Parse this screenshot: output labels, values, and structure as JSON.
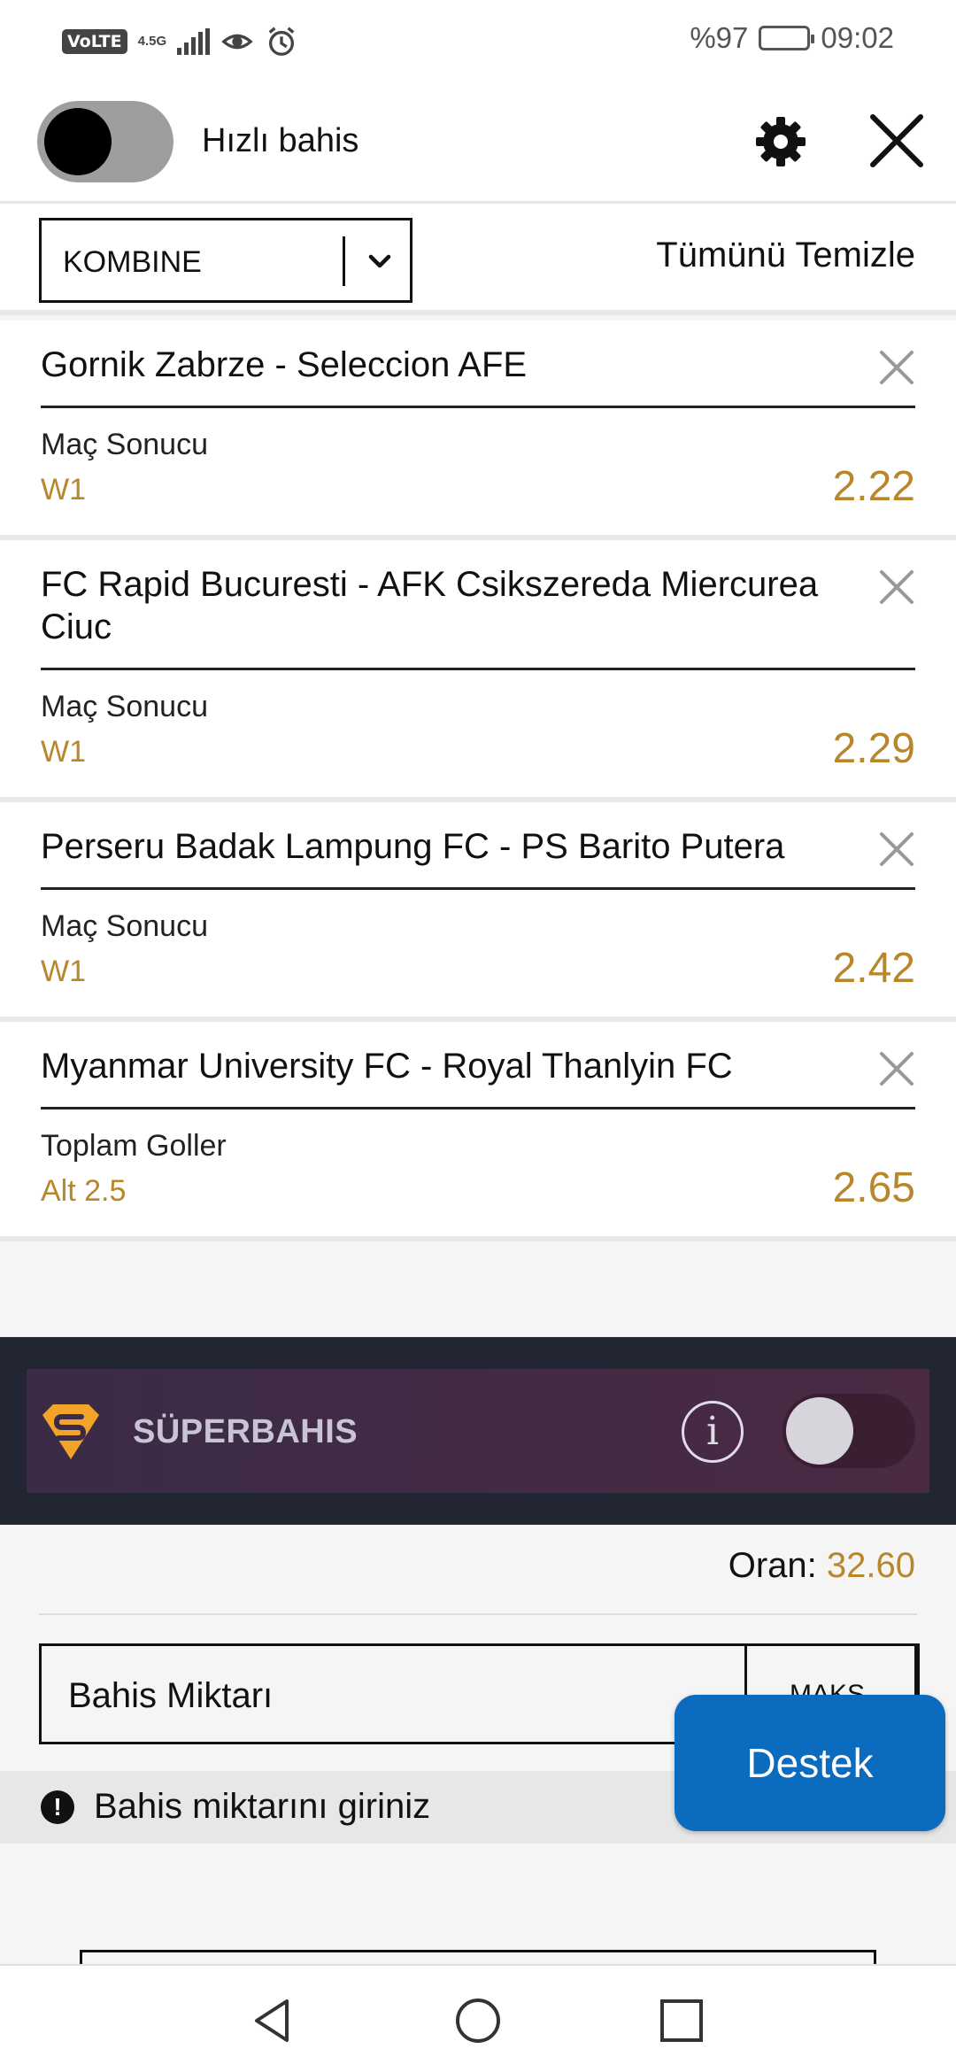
{
  "status_bar": {
    "volte": "VoLTE",
    "network": "4.5G",
    "battery_text": "%97",
    "time": "09:02",
    "icons": [
      "signal-icon",
      "eye-icon",
      "alarm-icon",
      "battery-icon"
    ]
  },
  "header": {
    "quick_bet_label": "Hızlı bahis",
    "quick_bet_on": false,
    "icons": [
      "settings-gear-icon",
      "close-icon"
    ]
  },
  "bet_type": {
    "selected": "KOMBINE",
    "clear_all_label": "Tümünü Temizle"
  },
  "bets": [
    {
      "match": "Gornik Zabrze - Seleccion AFE",
      "market": "Maç Sonucu",
      "selection": "W1",
      "odd": "2.22"
    },
    {
      "match": "FC Rapid Bucuresti - AFK Csikszereda Miercurea Ciuc",
      "market": "Maç Sonucu",
      "selection": "W1",
      "odd": "2.29"
    },
    {
      "match": "Perseru Badak Lampung FC - PS Barito Putera",
      "market": "Maç Sonucu",
      "selection": "W1",
      "odd": "2.42"
    },
    {
      "match": "Myanmar University FC - Royal Thanlyin FC",
      "market": "Toplam Goller",
      "selection": "Alt 2.5",
      "odd": "2.65"
    }
  ],
  "superbahis": {
    "label": "SÜPERBAHIS",
    "info_glyph": "i",
    "enabled": false
  },
  "summary": {
    "oran_label": "Oran:",
    "oran_value": "32.60",
    "amount_placeholder": "Bahis Miktarı",
    "max_label": "MAKS",
    "warning": "Bahis miktarını giriniz",
    "warning_glyph": "!"
  },
  "support_button": "Destek",
  "colors": {
    "accent_gold": "#b8862b",
    "support_blue": "#0a6bbf",
    "super_bg": "#222632"
  }
}
